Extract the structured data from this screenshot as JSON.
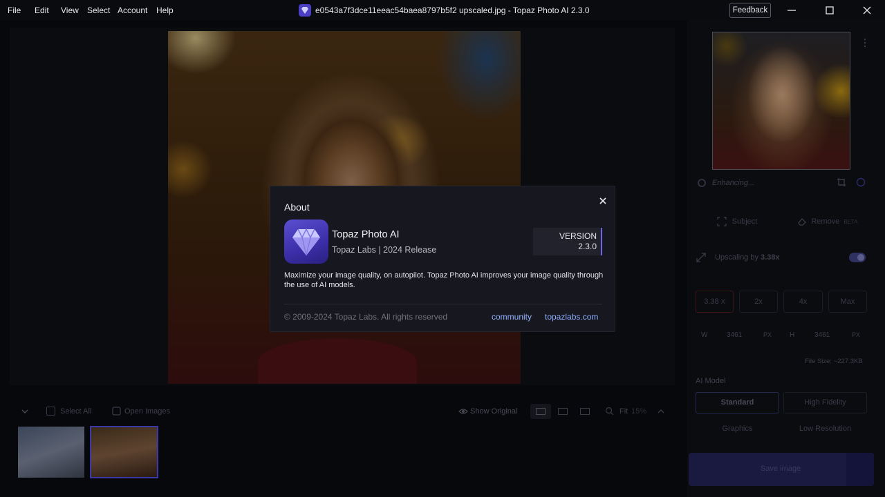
{
  "menu": [
    "File",
    "Edit",
    "View",
    "Select",
    "Account",
    "Help"
  ],
  "window": {
    "title": "e0543a7f3dce11eeac54baea8797b5f2 upscaled.jpg - Topaz Photo AI 2.3.0",
    "feedback": "Feedback"
  },
  "right_panel": {
    "status": "Enhancing...",
    "subject": "Subject",
    "remove": "Remove",
    "beta": "BETA",
    "upscaling_prefix": "Upscaling by ",
    "upscaling_value": "3.38x",
    "scale_input": "3.38",
    "scale_unit": "X",
    "scale_options": [
      "2x",
      "4x",
      "Max"
    ],
    "w_label": "W",
    "w_value": "3461",
    "h_label": "H",
    "h_value": "3461",
    "unit": "PX",
    "file_size": "File Size: ~227.3KB",
    "ai_model_label": "AI Model",
    "models": [
      "Standard",
      "High Fidelity",
      "Graphics",
      "Low Resolution"
    ],
    "save": "Save image"
  },
  "bottom_bar": {
    "select_all": "Select All",
    "open_images": "Open Images",
    "show_original": "Show Original",
    "fit": "Fit",
    "zoom": "15%"
  },
  "about": {
    "title": "About",
    "app_name": "Topaz Photo AI",
    "subtitle": "Topaz Labs | 2024 Release",
    "version_label": "VERSION",
    "version": "2.3.0",
    "description": "Maximize your image quality, on autopilot. Topaz Photo AI improves your image quality through the use of AI models.",
    "copyright": "© 2009-2024 Topaz Labs. All rights reserved",
    "links": [
      "community",
      "topazlabs.com"
    ]
  },
  "colors": {
    "accent": "#6e66e6",
    "link": "#8fb0ff",
    "dialog_bg": "#17181f",
    "save_bg": "#262658"
  }
}
